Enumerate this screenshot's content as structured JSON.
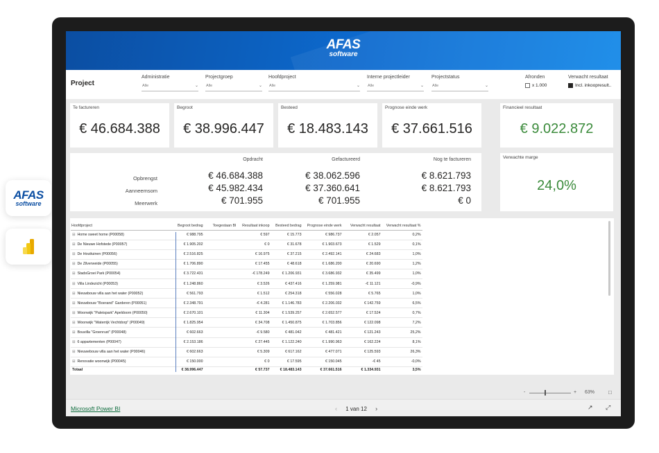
{
  "brand": {
    "line1": "AFAS",
    "line2": "software"
  },
  "header": {
    "title": "Project"
  },
  "filters": [
    {
      "label": "Administratie",
      "value": "Alle"
    },
    {
      "label": "Projectgroep",
      "value": "Alle"
    },
    {
      "label": "Hoofdproject",
      "value": "Alle"
    },
    {
      "label": "Interne projectleider",
      "value": "Alle"
    },
    {
      "label": "Projectstatus",
      "value": "Alle"
    }
  ],
  "afronden": {
    "label": "Afronden",
    "option": "x 1.000"
  },
  "verwacht": {
    "label": "Verwacht resultaat",
    "option": "Incl. inkoopresult.."
  },
  "kpis": [
    {
      "title": "Te factureren",
      "value": "€ 46.684.388"
    },
    {
      "title": "Begroot",
      "value": "€ 38.996.447"
    },
    {
      "title": "Besteed",
      "value": "€ 18.483.143"
    },
    {
      "title": "Prognose einde werk",
      "value": "€ 37.661.516"
    }
  ],
  "financieel": {
    "title": "Financieel resultaat",
    "value": "€ 9.022.872"
  },
  "marge": {
    "title": "Verwachte marge",
    "value": "24,0%"
  },
  "opdracht": {
    "headers": [
      "Opdracht",
      "Gefactureerd",
      "Nog te factureren"
    ],
    "rows": [
      {
        "label": "Opbrengst",
        "values": [
          "€ 46.684.388",
          "€ 38.062.596",
          "€ 8.621.793"
        ]
      },
      {
        "label": "Aanneemsom",
        "values": [
          "€ 45.982.434",
          "€ 37.360.641",
          "€ 8.621.793"
        ]
      },
      {
        "label": "Meerwerk",
        "values": [
          "€ 701.955",
          "€ 701.955",
          "€ 0"
        ]
      }
    ]
  },
  "table": {
    "headers": [
      "Hoofdproject",
      "Begroot bedrag",
      "Toegestaan BI",
      "Resultaat inkoop",
      "Besteed bedrag",
      "Prognose einde werk",
      "Verwacht resultaat",
      "Verwacht resultaat %"
    ],
    "rows": [
      [
        "Home sweet home (P00058)",
        "€ 988.795",
        "",
        "€ 597",
        "€ 15.773",
        "€ 986.737",
        "€ 2.057",
        "0,2%"
      ],
      [
        "De Nieuwe Hofstede (P00057)",
        "€ 1.905.202",
        "",
        "€ 0",
        "€ 31.678",
        "€ 1.903.673",
        "€ 1.529",
        "0,1%"
      ],
      [
        "De Houttuinen (P00056)",
        "€ 2.516.825",
        "",
        "€ 16.975",
        "€ 37.215",
        "€ 2.492.141",
        "€ 24.683",
        "1,0%"
      ],
      [
        "De Zilverweide (P00055)",
        "€ 1.706.890",
        "",
        "€ 17.455",
        "€ 48.618",
        "€ 1.686.200",
        "€ 20.690",
        "1,2%"
      ],
      [
        "StadsGroei Park (P00054)",
        "€ 3.722.431",
        "",
        "-€ 178.249",
        "€ 1.206.931",
        "€ 3.686.932",
        "€ 35.499",
        "1,0%"
      ],
      [
        "Villa Lindezicht (P00053)",
        "€ 1.248.860",
        "",
        "€ 3.526",
        "€ 437.416",
        "€ 1.259.981",
        "-€ 11.121",
        "-0,9%"
      ],
      [
        "Nieuwbouw villa aan het water (P00052)",
        "€ 561.793",
        "",
        "€ 1.512",
        "€ 254.318",
        "€ 556.028",
        "€ 5.765",
        "1,0%"
      ],
      [
        "Nieuwbouw \"Boerand\" Garderen (P00051)",
        "€ 2.348.791",
        "",
        "-€ 4.281",
        "€ 1.146.783",
        "€ 2.206.032",
        "€ 142.759",
        "6,5%"
      ],
      [
        "Woonwijk \"Paleispark\" Apeldoorn (P00050)",
        "€ 2.670.101",
        "",
        "€ 11.304",
        "€ 1.539.257",
        "€ 2.652.577",
        "€ 17.524",
        "0,7%"
      ],
      [
        "Woonwijk \"Waterrijk Vechtdorp\" (P00049)",
        "€ 1.825.954",
        "",
        "€ 34.708",
        "€ 1.450.875",
        "€ 1.703.856",
        "€ 122.098",
        "7,2%"
      ],
      [
        "Bouvilla \"Groenrust\" (P00048)",
        "€ 602.663",
        "",
        "-€ 9.580",
        "€ 481.042",
        "€ 481.421",
        "€ 121.243",
        "25,2%"
      ],
      [
        "6 appartementen (P00047)",
        "€ 2.153.186",
        "",
        "€ 27.445",
        "€ 1.122.240",
        "€ 1.990.963",
        "€ 162.224",
        "8,1%"
      ],
      [
        "Nieuwebouw villa aan het water (P00046)",
        "€ 602.663",
        "",
        "€ 5.309",
        "€ 617.162",
        "€ 477.071",
        "€ 125.593",
        "26,3%"
      ],
      [
        "Renovatie woonwijk (P00045)",
        "€ 150.000",
        "",
        "€ 0",
        "€ 17.595",
        "€ 150.045",
        "-€ 45",
        "-0,0%"
      ]
    ],
    "total": [
      "Totaal",
      "€ 38.996.447",
      "",
      "€ 57.737",
      "€ 18.483.143",
      "€ 37.661.516",
      "€ 1.334.931",
      "3,5%"
    ]
  },
  "zoom": {
    "value": "63%",
    "minus": "-",
    "plus": "+"
  },
  "footer": {
    "link": "Microsoft Power BI",
    "page": "1 van 12"
  }
}
